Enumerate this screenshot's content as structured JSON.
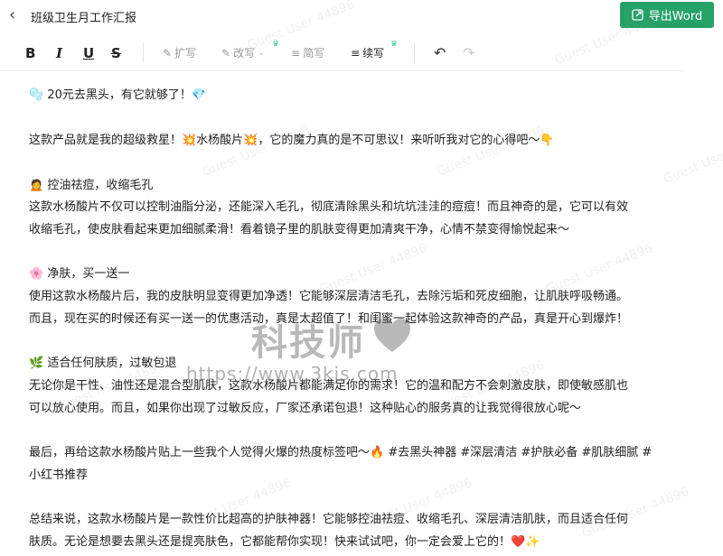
{
  "header": {
    "title": "班级卫生月工作汇报",
    "export_label": "导出Word"
  },
  "toolbar": {
    "bold": "B",
    "italic": "I",
    "underline": "U",
    "strike": "S",
    "expand": "扩写",
    "rewrite": "改写",
    "simplify": "简写",
    "continue": "续写"
  },
  "document": {
    "lines": [
      "🫧 20元去黑头，有它就够了！💎",
      "这款产品就是我的超级救星！💥水杨酸片💥，它的魔力真的是不可思议！来听听我对它的心得吧～👇",
      "🙍 控油祛痘，收缩毛孔",
      "这款水杨酸片不仅可以控制油脂分泌，还能深入毛孔，彻底清除黑头和坑坑洼洼的痘痘！而且神奇的是，它可以有效",
      "收缩毛孔，使皮肤看起来更加细腻柔滑！看着镜子里的肌肤变得更加清爽干净，心情不禁变得愉悦起来～",
      "🌸 净肤，买一送一",
      "使用这款水杨酸片后，我的皮肤明显变得更加净透！它能够深层清洁毛孔，去除污垢和死皮细胞，让肌肤呼吸畅通。",
      "而且，现在买的时候还有买一送一的优惠活动，真是太超值了！和闺蜜一起体验这款神奇的产品，真是开心到爆炸！",
      "🌿 适合任何肤质，过敏包退",
      "无论你是干性、油性还是混合型肌肤，这款水杨酸片都能满足你的需求！它的温和配方不会刺激皮肤，即使敏感肌也",
      "可以放心使用。而且，如果你出现了过敏反应，厂家还承诺包退！这种贴心的服务真的让我觉得很放心呢～",
      "最后，再给这款水杨酸片贴上一些我个人觉得火爆的热度标签吧～🔥 #去黑头神器 #深层清洁 #护肤必备 #肌肤细腻 #",
      "小红书推荐",
      "总结来说，这款水杨酸片是一款性价比超高的护肤神器！它能够控油祛痘、收缩毛孔、深层清洁肌肤，而且适合任何",
      "肤质。无论是想要去黑头还是提亮肤色，它都能帮你实现！快来试试吧，你一定会爱上它的！❤️✨"
    ]
  },
  "watermark": {
    "text": "Guest User 44896",
    "logo": "科技师",
    "url": "https://www.3kjs.com"
  }
}
